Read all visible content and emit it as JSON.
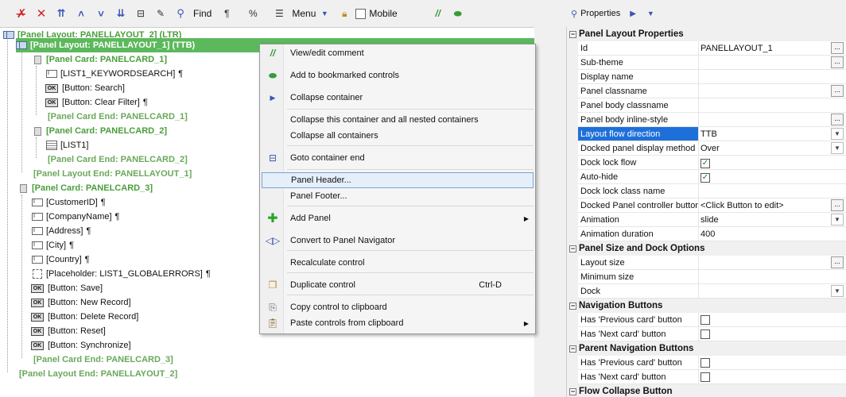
{
  "toolbar": {
    "find_label": "Find",
    "pilcrow": "¶",
    "percent": "%",
    "menu_label": "Menu",
    "mobile_label": "Mobile"
  },
  "tree": {
    "rows": [
      {
        "text": "[Panel Layout: PANELLAYOUT_2] (LTR)",
        "pil": ""
      },
      {
        "text": "[Panel Layout: PANELLAYOUT_1] (TTB)",
        "pil": ""
      },
      {
        "text": "[Panel Card: PANELCARD_1]",
        "pil": ""
      },
      {
        "text": "[LIST1_KEYWORDSEARCH]",
        "pil": "¶"
      },
      {
        "text": "[Button: Search]",
        "pil": ""
      },
      {
        "text": "[Button: Clear Filter]",
        "pil": "¶"
      },
      {
        "text": "[Panel Card End: PANELCARD_1]",
        "pil": ""
      },
      {
        "text": "[Panel Card: PANELCARD_2]",
        "pil": ""
      },
      {
        "text": "[LIST1]",
        "pil": ""
      },
      {
        "text": "[Panel Card End: PANELCARD_2]",
        "pil": ""
      },
      {
        "text": "[Panel Layout End: PANELLAYOUT_1]",
        "pil": ""
      },
      {
        "text": "[Panel Card: PANELCARD_3]",
        "pil": ""
      },
      {
        "text": "[CustomerID]",
        "pil": "¶"
      },
      {
        "text": "[CompanyName]",
        "pil": "¶"
      },
      {
        "text": "[Address]",
        "pil": "¶"
      },
      {
        "text": "[City]",
        "pil": "¶"
      },
      {
        "text": "[Country]",
        "pil": "¶"
      },
      {
        "text": "[Placeholder: LIST1_GLOBALERRORS]",
        "pil": "¶"
      },
      {
        "text": "[Button: Save]",
        "pil": ""
      },
      {
        "text": "[Button: New Record]",
        "pil": ""
      },
      {
        "text": "[Button: Delete Record]",
        "pil": ""
      },
      {
        "text": "[Button: Reset]",
        "pil": ""
      },
      {
        "text": "[Button: Synchronize]",
        "pil": ""
      },
      {
        "text": "[Panel Card End: PANELCARD_3]",
        "pil": ""
      },
      {
        "text": "[Panel Layout End: PANELLAYOUT_2]",
        "pil": ""
      }
    ]
  },
  "context_menu": {
    "items": [
      {
        "label": "View/edit comment",
        "shortcut": ""
      },
      {
        "label": "Add to bookmarked controls",
        "shortcut": ""
      },
      {
        "label": "Collapse container",
        "shortcut": ""
      },
      {
        "label": "Collapse this container and all nested containers",
        "shortcut": ""
      },
      {
        "label": "Collapse all containers",
        "shortcut": ""
      },
      {
        "label": "Goto container end",
        "shortcut": ""
      },
      {
        "label": "Panel Header...",
        "shortcut": ""
      },
      {
        "label": "Panel Footer...",
        "shortcut": ""
      },
      {
        "label": "Add Panel",
        "shortcut": ""
      },
      {
        "label": "Convert to Panel Navigator",
        "shortcut": ""
      },
      {
        "label": "Recalculate control",
        "shortcut": ""
      },
      {
        "label": "Duplicate control",
        "shortcut": "Ctrl-D"
      },
      {
        "label": "Copy control to clipboard",
        "shortcut": ""
      },
      {
        "label": "Paste controls from clipboard",
        "shortcut": ""
      }
    ]
  },
  "properties": {
    "header_label": "Properties",
    "cat1": "Panel Layout Properties",
    "rows1": [
      {
        "name": "Id",
        "value": "PANELLAYOUT_1"
      },
      {
        "name": "Sub-theme",
        "value": ""
      },
      {
        "name": "Display name",
        "value": ""
      },
      {
        "name": "Panel classname",
        "value": ""
      },
      {
        "name": "Panel body classname",
        "value": ""
      },
      {
        "name": "Panel body inline-style",
        "value": ""
      },
      {
        "name": "Layout flow direction",
        "value": "TTB"
      },
      {
        "name": "Docked panel display method",
        "value": "Over"
      },
      {
        "name": "Dock lock flow",
        "value": ""
      },
      {
        "name": "Auto-hide",
        "value": ""
      },
      {
        "name": "Dock lock class name",
        "value": ""
      },
      {
        "name": "Docked Panel controller button",
        "value": "<Click Button to edit>"
      },
      {
        "name": "Animation",
        "value": "slide"
      },
      {
        "name": "Animation duration",
        "value": "400"
      }
    ],
    "cat2": "Panel Size and Dock Options",
    "rows2": [
      {
        "name": "Layout size",
        "value": ""
      },
      {
        "name": "Minimum size",
        "value": ""
      },
      {
        "name": "Dock",
        "value": ""
      }
    ],
    "cat3": "Navigation Buttons",
    "rows3": [
      {
        "name": "Has 'Previous card' button",
        "value": ""
      },
      {
        "name": "Has 'Next card' button",
        "value": ""
      }
    ],
    "cat4": "Parent Navigation Buttons",
    "rows4": [
      {
        "name": "Has 'Previous card' button",
        "value": ""
      },
      {
        "name": "Has 'Next card' button",
        "value": ""
      }
    ],
    "cat5": "Flow Collapse Button"
  }
}
